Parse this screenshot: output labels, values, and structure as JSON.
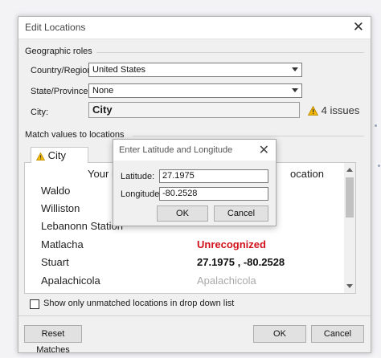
{
  "dialog": {
    "title": "Edit Locations",
    "geographic_roles_label": "Geographic roles",
    "country": {
      "label": "Country/Region:",
      "value": "United States"
    },
    "state": {
      "label": "State/Province:",
      "value": "None"
    },
    "city": {
      "label": "City:",
      "value": "City"
    },
    "issues_text": "4 issues",
    "match_label": "Match values to locations",
    "tab_label": "City",
    "column_left_header": "Your D",
    "column_right_header": "ocation",
    "rows": [
      {
        "your_data": "Waldo",
        "location": ""
      },
      {
        "your_data": "Williston",
        "location": ""
      },
      {
        "your_data": "Lebanonn Station",
        "location": ""
      },
      {
        "your_data": "Matlacha",
        "location": "Unrecognized",
        "status": "red"
      },
      {
        "your_data": "Stuart",
        "location": "27.1975 , -80.2528",
        "status": "bold"
      },
      {
        "your_data": "Apalachicola",
        "location": "Apalachicola",
        "status": "grey"
      }
    ],
    "show_unmatched_label": "Show only unmatched locations in drop down list",
    "reset_button": "Reset Matches",
    "ok_button": "OK",
    "cancel_button": "Cancel"
  },
  "latlong_dialog": {
    "title": "Enter Latitude and Longitude",
    "latitude_label": "Latitude:",
    "latitude_value": "27.1975",
    "longitude_label": "Longitude:",
    "longitude_value": "-80.2528",
    "ok_button": "OK",
    "cancel_button": "Cancel"
  },
  "colors": {
    "unrecognized": "#d0111b",
    "warning": "#f2b705"
  }
}
